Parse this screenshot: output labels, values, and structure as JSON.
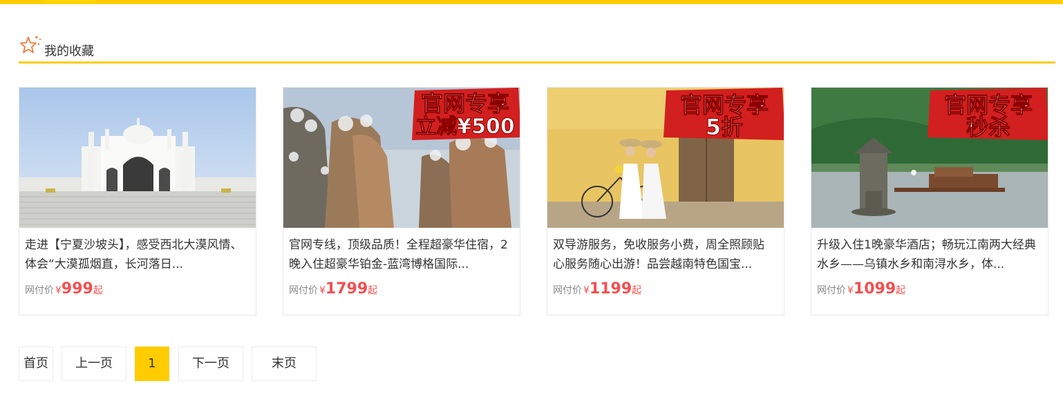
{
  "header": {
    "title": "我的收藏",
    "icon": "star-icon",
    "accent_color": "#ffcc00"
  },
  "favorites": [
    {
      "description": "走进【宁夏沙坡头】，感受西北大漠风情、体会“大漠孤烟直，长河落日...",
      "price_label": "网付价",
      "currency": "¥",
      "price": "999",
      "suffix": "起",
      "badge": {
        "line1": "",
        "line2": ""
      }
    },
    {
      "description": "官网专线，顶级品质！全程超豪华住宿，2晚入住超豪华铂金-蓝湾博格国际...",
      "price_label": "网付价",
      "currency": "¥",
      "price": "1799",
      "suffix": "起",
      "badge": {
        "line1": "官网专享",
        "line2": "立减¥500"
      }
    },
    {
      "description": "双导游服务，免收服务小费，周全照顾贴心服务随心出游！品尝越南特色国宝...",
      "price_label": "网付价",
      "currency": "¥",
      "price": "1199",
      "suffix": "起",
      "badge": {
        "line1": "官网专享",
        "line2": "5折"
      }
    },
    {
      "description": "升级入住1晚豪华酒店；畅玩江南两大经典水乡——乌镇水乡和南浔水乡，体...",
      "price_label": "网付价",
      "currency": "¥",
      "price": "1099",
      "suffix": "起",
      "badge": {
        "line1": "官网专享",
        "line2": "秒杀"
      }
    }
  ],
  "pagination": {
    "first": "首页",
    "prev": "上一页",
    "current": "1",
    "next": "下一页",
    "last": "末页"
  },
  "colors": {
    "price": "#f25050",
    "badge": "#d21f1f",
    "accent": "#ffcc00"
  }
}
